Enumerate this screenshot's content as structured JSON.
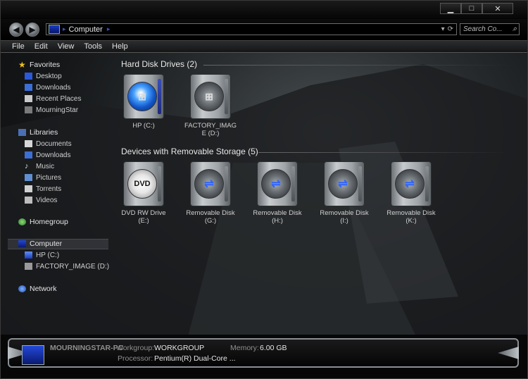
{
  "window": {
    "minimize": "▁",
    "maximize": "□",
    "close": "✕"
  },
  "nav": {
    "back": "◀",
    "forward": "▶",
    "address": "Computer",
    "refresh": "⟳",
    "search_placeholder": "Search Co...",
    "search_icon": "⌕"
  },
  "menu": [
    "File",
    "Edit",
    "View",
    "Tools",
    "Help"
  ],
  "sidebar": {
    "favorites": {
      "label": "Favorites",
      "items": [
        "Desktop",
        "Downloads",
        "Recent Places",
        "MourningStar"
      ]
    },
    "libraries": {
      "label": "Libraries",
      "items": [
        "Documents",
        "Downloads",
        "Music",
        "Pictures",
        "Torrents",
        "Videos"
      ]
    },
    "homegroup": "Homegroup",
    "computer": {
      "label": "Computer",
      "items": [
        "HP (C:)",
        "FACTORY_IMAGE (D:)"
      ]
    },
    "network": "Network"
  },
  "groups": [
    {
      "title": "Hard Disk Drives (2)",
      "drives": [
        {
          "line1": "HP (C:)",
          "line2": "",
          "icon": "windows-drive-icon"
        },
        {
          "line1": "FACTORY_IMAG",
          "line2": "E (D:)",
          "icon": "hard-disk-icon"
        }
      ]
    },
    {
      "title": "Devices with Removable Storage (5)",
      "drives": [
        {
          "line1": "DVD RW Drive",
          "line2": "(E:)",
          "icon": "dvd-drive-icon"
        },
        {
          "line1": "Removable Disk",
          "line2": "(G:)",
          "icon": "usb-drive-icon"
        },
        {
          "line1": "Removable Disk",
          "line2": "(H:)",
          "icon": "usb-drive-icon"
        },
        {
          "line1": "Removable Disk",
          "line2": "(I:)",
          "icon": "usb-drive-icon"
        },
        {
          "line1": "Removable Disk",
          "line2": "(K:)",
          "icon": "usb-drive-icon"
        }
      ]
    }
  ],
  "status": {
    "name": "MOURNINGSTAR-PC",
    "workgroup_label": "Workgroup:",
    "workgroup": "WORKGROUP",
    "memory_label": "Memory:",
    "memory": "6.00 GB",
    "processor_label": "Processor:",
    "processor": "Pentium(R) Dual-Core ..."
  },
  "colors": {
    "accent": "#2e55d6",
    "text": "#d8d8d8"
  }
}
